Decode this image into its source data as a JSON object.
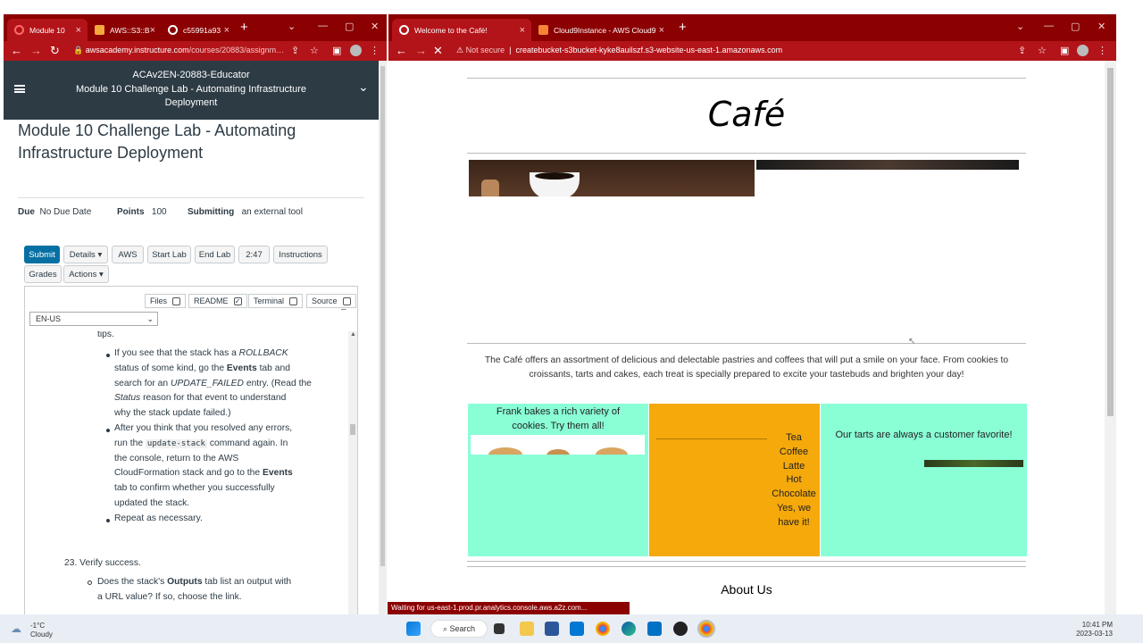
{
  "left_browser": {
    "tabs": [
      {
        "label": "Module 10",
        "active": true
      },
      {
        "label": "AWS::S3::B"
      },
      {
        "label": "c55991a93"
      }
    ],
    "url_domain": "awsacademy.instructure.com",
    "url_path": "/courses/20883/assignm…",
    "canvas_header": {
      "course": "ACAv2EN-20883-Educator",
      "line2": "Module 10 Challenge Lab - Automating Infrastructure",
      "line3": "Deployment"
    },
    "title_line1": "Module 10 Challenge Lab - Automating",
    "title_line2": "Infrastructure Deployment",
    "meta": {
      "due_label": "Due",
      "due_value": "No Due Date",
      "points_label": "Points",
      "points_value": "100",
      "submitting_label": "Submitting",
      "submitting_value": "an external tool"
    },
    "buttons": {
      "submit": "Submit",
      "details": "Details ▾",
      "aws": "AWS",
      "start_lab": "Start Lab",
      "end_lab": "End Lab",
      "timer": "2:47",
      "instructions": "Instructions",
      "grades": "Grades",
      "actions": "Actions ▾"
    },
    "toggles": {
      "files": "Files",
      "readme": "README",
      "terminal": "Terminal",
      "source": "Source"
    },
    "language": "EN-US",
    "content": {
      "tips": "tips.",
      "b1_a": "If you see that the stack has a ",
      "b1_rollback": "ROLLBACK",
      "b1_b": "status of some kind, go the ",
      "b1_events": "Events",
      "b1_c": " tab and",
      "b1_d": "search for an ",
      "b1_update": "UPDATE_FAILED",
      "b1_e": " entry. (Read the",
      "b1_status": "Status",
      "b1_f": " reason for that event to understand",
      "b1_g": "why the stack update failed.)",
      "b2_a": "After you think that you resolved any errors,",
      "b2_b": "run the ",
      "b2_code": "update-stack",
      "b2_c": " command again. In",
      "b2_d": "the console, return to the AWS",
      "b2_e": "CloudFormation stack and go to the ",
      "b2_events": "Events",
      "b2_f": "tab to confirm whether you successfully",
      "b2_g": "updated the stack.",
      "b3": "Repeat as necessary.",
      "step23": "23. Verify success.",
      "q_a": "Does the stack's ",
      "q_outputs": "Outputs",
      "q_b": " tab list an output with",
      "q_c": "a URL value? If so, choose the link."
    }
  },
  "right_browser": {
    "tabs": [
      {
        "label": "Welcome to the Café!",
        "active": true
      },
      {
        "label": "Cloud9Instance - AWS Cloud9"
      }
    ],
    "not_secure": "Not secure",
    "url": "createbucket-s3bucket-kyke8auilszf.s3-website-us-east-1.amazonaws.com",
    "site": {
      "title": "Café",
      "description_1": "The Café offers an assortment of delicious and delectable pastries and coffees that will put a smile on your face. From cookies to",
      "description_2": "croissants, tarts and cakes, each treat is specially prepared to excite your tastebuds and brighten your day!",
      "col1_text_1": "Frank bakes a rich variety of",
      "col1_text_2": "cookies. Try them all!",
      "col2_items": [
        "Tea",
        "Coffee",
        "Latte",
        "Hot",
        "Chocolate",
        "Yes, we",
        "have it!"
      ],
      "col3_text": "Our tarts are always a customer favorite!",
      "about": "About Us",
      "colors": {
        "mint": "#8affd6",
        "orange": "#f5a90a"
      }
    },
    "status": "Waiting for us-east-1.prod.pr.analytics.console.aws.a2z.com..."
  },
  "taskbar": {
    "weather_temp": "-1°C",
    "weather_desc": "Cloudy",
    "search": "Search",
    "time": "10:41 PM",
    "date": "2023-03-13"
  }
}
